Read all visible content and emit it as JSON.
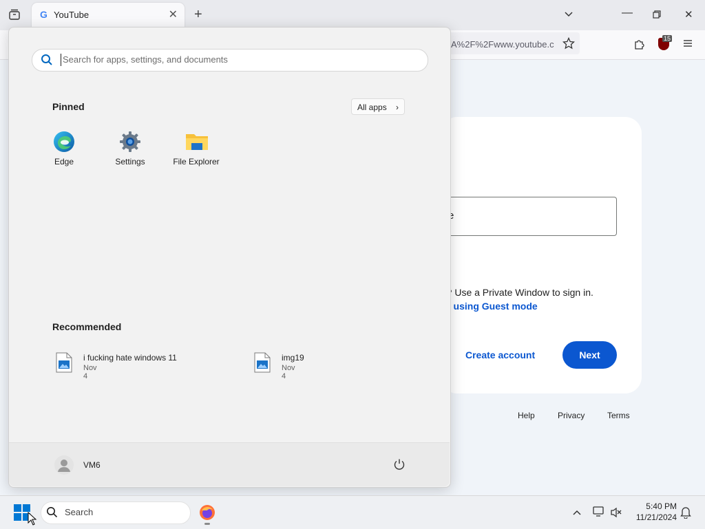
{
  "browser": {
    "tab_title": "YouTube",
    "tab_favicon": "G",
    "url_text": "A%2F%2Fwww.youtube.c",
    "extension_badge": "15"
  },
  "page": {
    "field_value_partial": "e",
    "private_text": "r? Use a Private Window to sign in.",
    "guest_link": "t using Guest mode",
    "create_account": "Create account",
    "next": "Next",
    "footer": [
      "Help",
      "Privacy",
      "Terms"
    ]
  },
  "start_menu": {
    "search_placeholder": "Search for apps, settings, and documents",
    "pinned_header": "Pinned",
    "all_apps": "All apps",
    "pinned": [
      {
        "label": "Edge",
        "icon": "edge-icon"
      },
      {
        "label": "Settings",
        "icon": "settings-gear-icon"
      },
      {
        "label": "File Explorer",
        "icon": "folder-icon"
      }
    ],
    "recommended_header": "Recommended",
    "recommended": [
      {
        "title": "i fucking hate windows 11",
        "date": "Nov 4"
      },
      {
        "title": "img19",
        "date": "Nov 4"
      }
    ],
    "user_name": "VM6"
  },
  "taskbar": {
    "search_label": "Search",
    "time": "5:40 PM",
    "date": "11/21/2024"
  },
  "colors": {
    "accent": "#0b57d0",
    "windows_blue": "#0078d4"
  }
}
